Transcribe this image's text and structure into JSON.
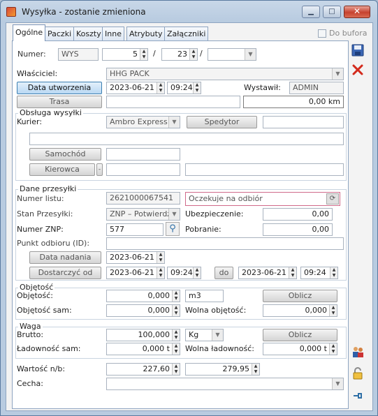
{
  "window": {
    "title": "Wysyłka - zostanie zmieniona",
    "minimize": "▁",
    "maximize": "□",
    "close": "✕"
  },
  "tabs": [
    "Ogólne",
    "Paczki",
    "Koszty",
    "Inne",
    "Atrybuty",
    "Załączniki"
  ],
  "do_bufora": "Do bufora",
  "numer": {
    "label": "Numer:",
    "prefix": "WYS",
    "n1": "5",
    "n2": "23",
    "sep": "/",
    "n3": ""
  },
  "wlasciciel": {
    "label": "Właściciel:",
    "value": "HHG PACK"
  },
  "data_utworzenia": {
    "button": "Data utworzenia",
    "date": "2023-06-21",
    "time": "09:24"
  },
  "wystawil": {
    "label": "Wystawił:",
    "value": "ADMIN"
  },
  "trasa": {
    "button": "Trasa",
    "value": "",
    "km": "0,00 km"
  },
  "obsluga": {
    "title": "Obsługa wysyłki",
    "kurier_label": "Kurier:",
    "kurier_value": "Ambro Express",
    "spedytor_button": "Spedytor",
    "spedytor_value": "",
    "samochod_button": "Samochód",
    "kierowca_button": "Kierowca",
    "kierowca_dash": "-"
  },
  "dane": {
    "title": "Dane przesyłki",
    "numer_listu_label": "Numer listu:",
    "numer_listu_value": "2621000067541",
    "status_value": "Oczekuje na odbiór",
    "stan_label": "Stan Przesyłki:",
    "stan_value": "ZNP – Potwierdzo",
    "ubezp_label": "Ubezpieczenie:",
    "ubezp_value": "0,00",
    "znp_label": "Numer ZNP:",
    "znp_value": "577",
    "pobranie_label": "Pobranie:",
    "pobranie_value": "0,00",
    "punkt_label": "Punkt odbioru (ID):",
    "punkt_value": "",
    "data_nadania_button": "Data nadania",
    "data_nadania_value": "2023-06-21",
    "dostarczyc_button": "Dostarczyć od",
    "dostarczyc_date": "2023-06-21",
    "dostarczyc_time": "09:24",
    "do_button": "do",
    "do_date": "2023-06-21",
    "do_time": "09:24"
  },
  "objetosc": {
    "title": "Objętość",
    "obj_label": "Objętość:",
    "obj_value": "0,000",
    "unit": "m3",
    "oblicz": "Oblicz",
    "obj_sam_label": "Objętość sam:",
    "obj_sam_value": "0,000",
    "wolna_label": "Wolna objętość:",
    "wolna_value": "0,000"
  },
  "waga": {
    "title": "Waga",
    "brutto_label": "Brutto:",
    "brutto_value": "100,000",
    "unit": "Kg",
    "oblicz": "Oblicz",
    "ladownosc_label": "Ładowność sam:",
    "ladownosc_value": "0,000 t",
    "wolna_label": "Wolna ładowność:",
    "wolna_value": "0,000 t"
  },
  "wartosc": {
    "label": "Wartość n/b:",
    "v1": "227,60",
    "v2": "279,95"
  },
  "cecha": {
    "label": "Cecha:",
    "value": ""
  },
  "icons": {
    "save": "save-icon",
    "delete": "delete-icon",
    "users": "users-icon",
    "lock": "lock-icon",
    "pin": "pin-icon"
  }
}
